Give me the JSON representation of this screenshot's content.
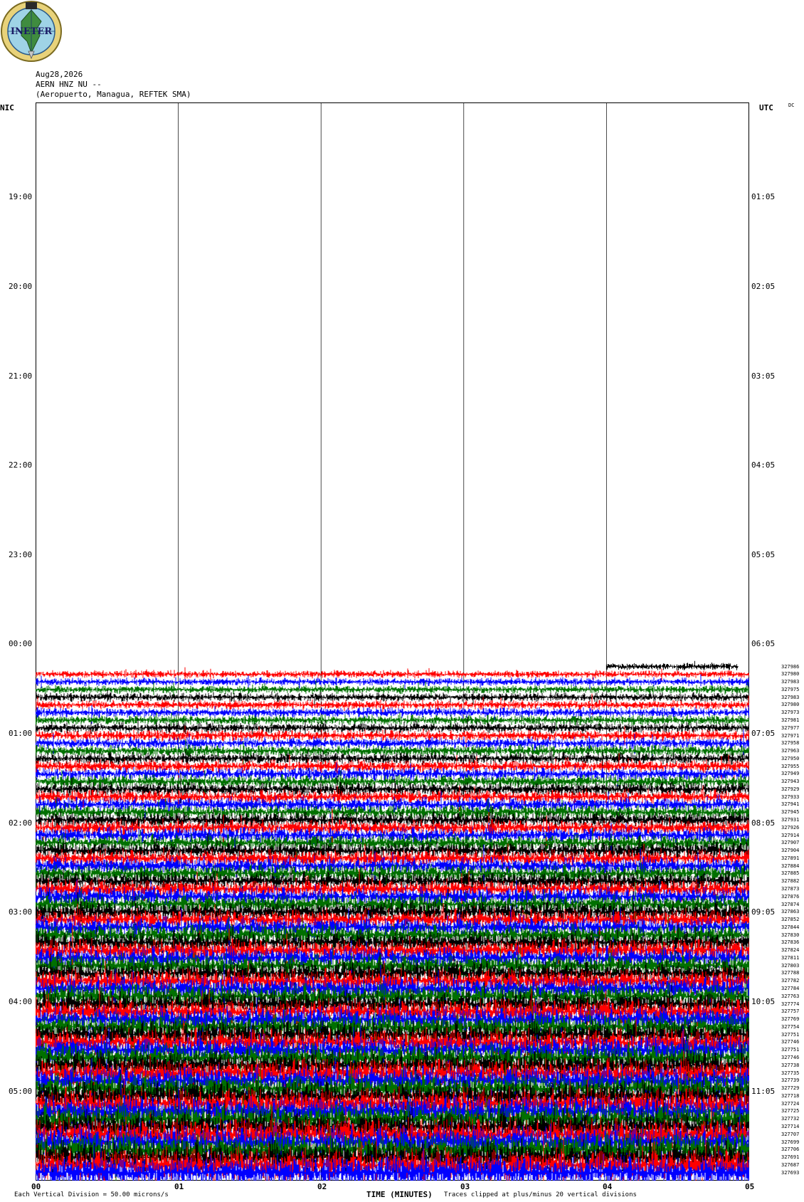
{
  "header": {
    "date": "Aug28,2026",
    "station": "AERN HNZ NU --",
    "location": "(Aeropuerto, Managua, REFTEK SMA)",
    "logo_text": "INETER"
  },
  "axes": {
    "left_tz": "NIC",
    "right_tz": "UTC",
    "dc_label": "DC",
    "xlabel": "TIME (MINUTES)",
    "x_ticks": [
      "00",
      "01",
      "02",
      "03",
      "04",
      "05"
    ]
  },
  "footer": {
    "scale_text": "Each Vertical Division = 50.00 microns/s",
    "clip_text": "Traces clipped at plus/minus 20 vertical divisions"
  },
  "chart_data": {
    "type": "line",
    "title": "",
    "xlabel": "TIME (MINUTES)",
    "ylabel": "",
    "xlim": [
      0,
      5
    ],
    "left_time_labels": [
      "19:00",
      "20:00",
      "21:00",
      "22:00",
      "23:00",
      "00:00",
      "01:00",
      "02:00",
      "03:00",
      "04:00",
      "05:00"
    ],
    "right_time_labels": [
      "01:05",
      "02:05",
      "03:05",
      "04:05",
      "05:05",
      "06:05",
      "07:05",
      "08:05",
      "09:05",
      "10:05",
      "11:05"
    ],
    "trace_colors": [
      "#ff0000",
      "#0000ff",
      "#007000",
      "#000000"
    ],
    "trace_start_hours_before_first_label": -5,
    "traces_per_hour": 12,
    "first_trace_row_after_0005": 2,
    "dc_values": [
      327986,
      327980,
      327983,
      327975,
      327983,
      327980,
      327973,
      327981,
      327977,
      327971,
      327958,
      327963,
      327950,
      327955,
      327949,
      327943,
      327929,
      327933,
      327941,
      327945,
      327931,
      327926,
      327914,
      327907,
      327904,
      327891,
      327884,
      327885,
      327882,
      327873,
      327876,
      327874,
      327863,
      327852,
      327844,
      327830,
      327836,
      327824,
      327811,
      327803,
      327788,
      327782,
      327784,
      327763,
      327774,
      327757,
      327769,
      327754,
      327751,
      327746,
      327751,
      327746,
      327738,
      327735,
      327739,
      327729,
      327718,
      327724,
      327725,
      327732,
      327714,
      327707,
      327699,
      327706,
      327691,
      327687,
      327693
    ]
  }
}
